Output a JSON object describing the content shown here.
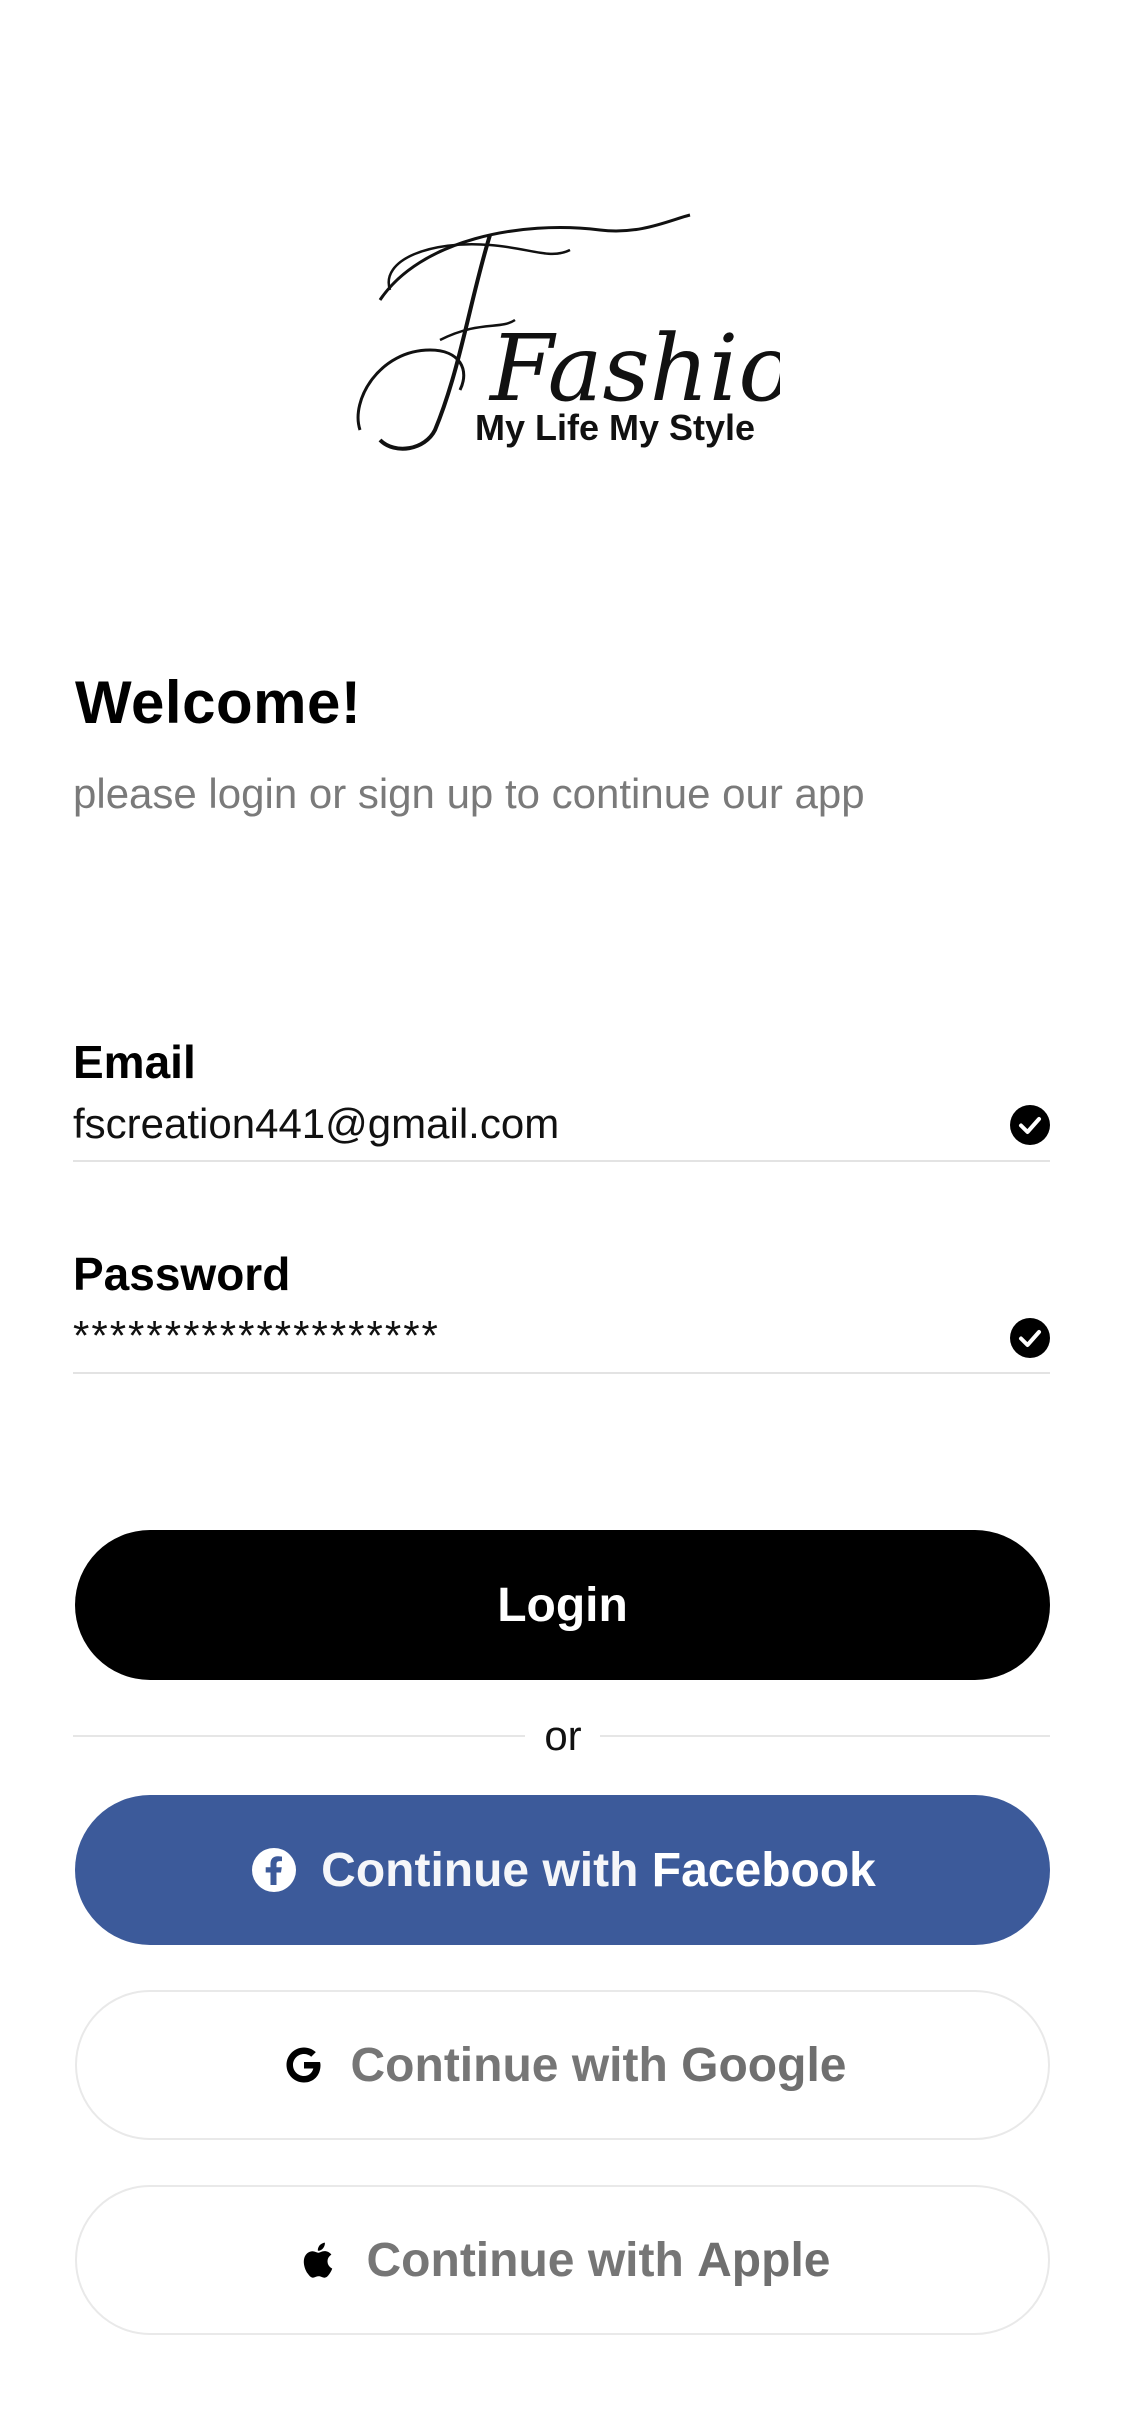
{
  "logo": {
    "wordmark": "Fashions",
    "tagline": "My Life My Style"
  },
  "welcome": {
    "title": "Welcome!",
    "subtitle": "please login or sign up to continue our app"
  },
  "form": {
    "email_label": "Email",
    "email_value": "fscreation441@gmail.com",
    "password_label": "Password",
    "password_value": "********************"
  },
  "buttons": {
    "login_label": "Login",
    "or_label": "or",
    "facebook_prefix": "Continue with",
    "facebook_brand": "Facebook",
    "google_prefix": "Continue with",
    "google_brand": "Google",
    "apple_prefix": "Continue with",
    "apple_brand": "Apple"
  },
  "colors": {
    "primary": "#000000",
    "facebook": "#3c5a9a",
    "muted_text": "#7a7a7a",
    "divider": "#e3e3e3"
  },
  "icons": {
    "email_status": "check-circle-icon",
    "password_status": "check-circle-icon",
    "facebook": "facebook-icon",
    "google": "google-icon",
    "apple": "apple-icon"
  }
}
